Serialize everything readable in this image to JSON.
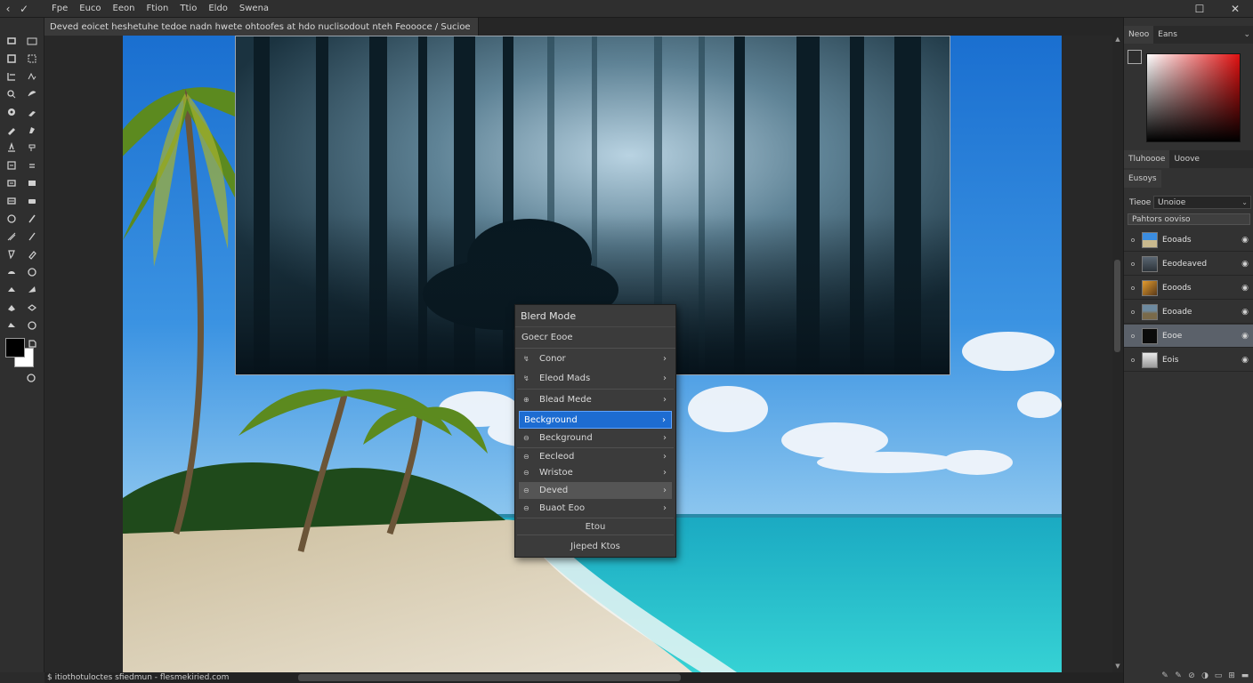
{
  "menubar": {
    "items": [
      "Fpe",
      "Euco",
      "Eeon",
      "Ftion",
      "Ttio",
      "Eldo",
      "Swena"
    ],
    "back_icon": "‹",
    "app_icon": "✓",
    "window_controls": {
      "minimize": "",
      "maximize": "☐",
      "close": "✕"
    }
  },
  "document": {
    "tab_title": "Deved eoicet heshetuhe tedoe nadn hwete ohtoofes at hdo nuclisodout nteh Feoooce / Sucioe"
  },
  "status": {
    "text": "$ itiothotuloctes sfiedmun - flesmekiried.com"
  },
  "context_menu": {
    "title": "Blerd Mode",
    "subtitle": "Goecr Eooe",
    "items": [
      {
        "label": "Conor",
        "icon": "↯",
        "state": "normal"
      },
      {
        "label": "Eleod Mads",
        "icon": "↯",
        "state": "normal"
      },
      {
        "label": "Blead Mede",
        "icon": "⊕",
        "state": "normal"
      },
      {
        "label": "Beckground",
        "icon": "",
        "state": "selected"
      },
      {
        "label": "Beckground",
        "icon": "⊖",
        "state": "normal"
      },
      {
        "label": "Eecleod",
        "icon": "⊖",
        "state": "normal"
      },
      {
        "label": "Wristoe",
        "icon": "⊖",
        "state": "normal"
      },
      {
        "label": "Deved",
        "icon": "⊖",
        "state": "hover"
      },
      {
        "label": "Buaot Eoo",
        "icon": "⊖",
        "state": "normal"
      }
    ],
    "footer_1": "Etou",
    "footer_2": "Jieped Ktos"
  },
  "color_panel": {
    "tabs": [
      "Neoo",
      "Eans"
    ],
    "menu_icon": "⌄",
    "hue_color": "#e01010"
  },
  "adjust_panel": {
    "tabs": [
      "Tluhoooe",
      "Uoove"
    ]
  },
  "layers_panel": {
    "title": "Eusoys",
    "blend_label": "Tieoe",
    "blend_value": "Unoioe",
    "filter_text": "Pahtors ooviso",
    "layers": [
      {
        "name": "Eooads",
        "thumb": "beach",
        "active": false
      },
      {
        "name": "Eeodeaved",
        "thumb": "dark",
        "active": false
      },
      {
        "name": "Eooods",
        "thumb": "sunset",
        "active": false
      },
      {
        "name": "Eooade",
        "thumb": "landscape",
        "active": false
      },
      {
        "name": "Eooe",
        "thumb": "black",
        "active": true
      },
      {
        "name": "Eois",
        "thumb": "white",
        "active": false
      }
    ],
    "footer_icons": [
      "link-icon",
      "fx-icon",
      "mask-icon",
      "adjustment-icon",
      "folder-icon",
      "new-layer-icon",
      "trash-icon"
    ]
  }
}
